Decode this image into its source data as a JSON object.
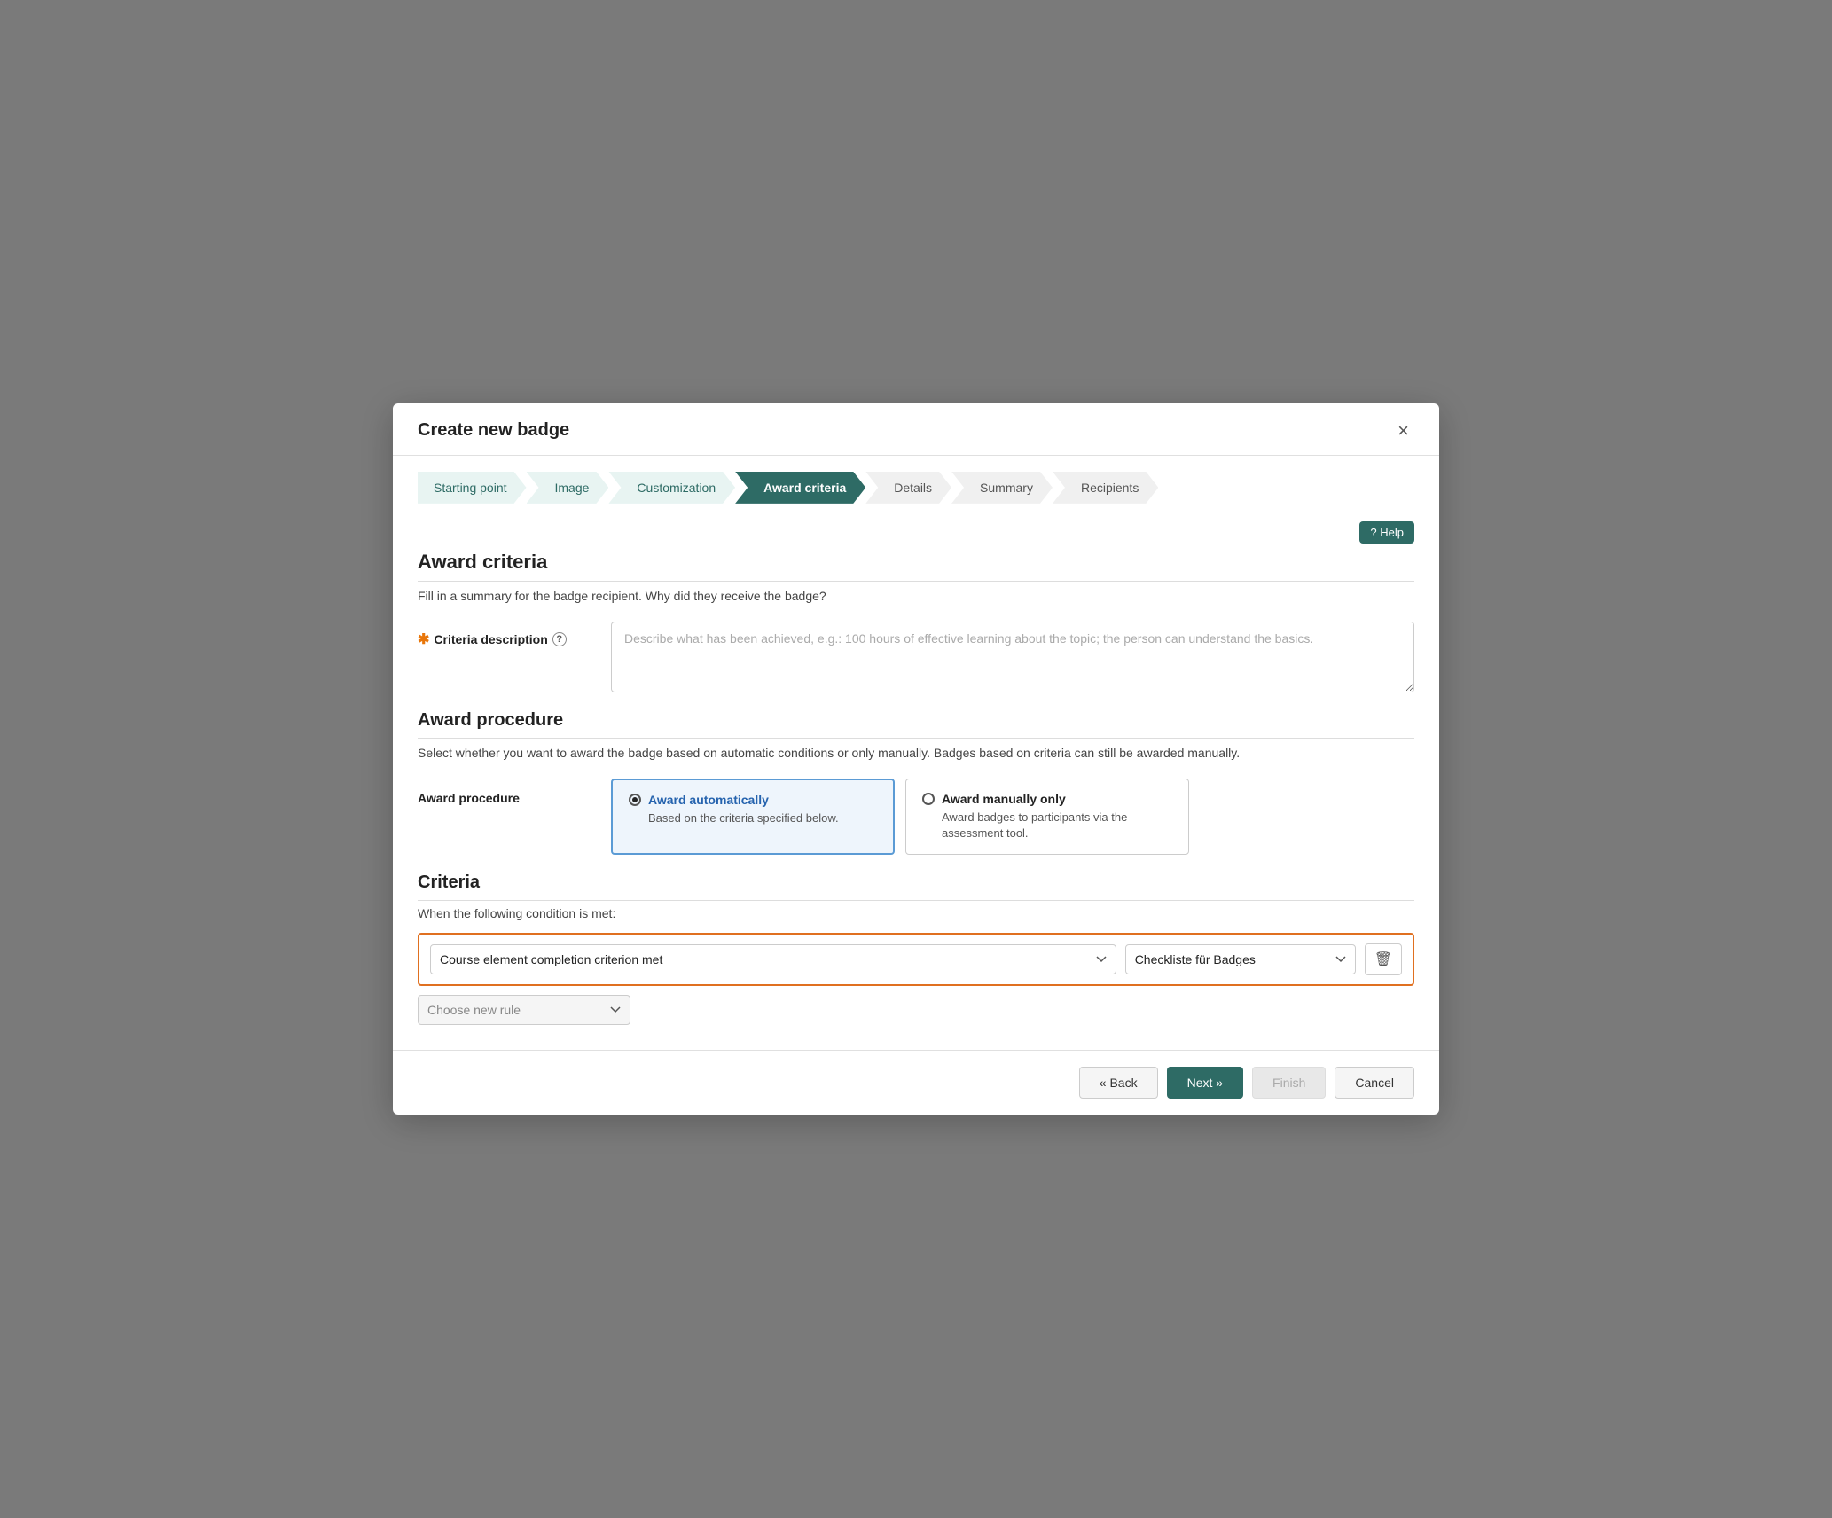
{
  "modal": {
    "title": "Create new badge",
    "close_label": "×"
  },
  "wizard": {
    "steps": [
      {
        "id": "starting-point",
        "label": "Starting point",
        "state": "completed"
      },
      {
        "id": "image",
        "label": "Image",
        "state": "completed"
      },
      {
        "id": "customization",
        "label": "Customization",
        "state": "completed"
      },
      {
        "id": "award-criteria",
        "label": "Award criteria",
        "state": "active"
      },
      {
        "id": "details",
        "label": "Details",
        "state": "inactive"
      },
      {
        "id": "summary",
        "label": "Summary",
        "state": "inactive"
      },
      {
        "id": "recipients",
        "label": "Recipients",
        "state": "inactive"
      }
    ]
  },
  "help_button": "? Help",
  "award_criteria": {
    "section_title": "Award criteria",
    "section_desc": "Fill in a summary for the badge recipient. Why did they receive the badge?",
    "criteria_description_label": "Criteria description",
    "criteria_description_placeholder": "Describe what has been achieved, e.g.: 100 hours of effective learning about the topic; the person can understand the basics."
  },
  "award_procedure": {
    "section_title": "Award procedure",
    "section_desc": "Select whether you want to award the badge based on automatic conditions or only manually. Badges based on criteria can still be awarded manually.",
    "label": "Award procedure",
    "options": [
      {
        "id": "auto",
        "title": "Award automatically",
        "desc": "Based on the criteria specified below.",
        "selected": true
      },
      {
        "id": "manual",
        "title": "Award manually only",
        "desc": "Award badges to participants via the assessment tool.",
        "selected": false
      }
    ]
  },
  "criteria": {
    "section_title": "Criteria",
    "condition_text": "When the following condition is met:",
    "rule": {
      "type_value": "Course element completion criterion met",
      "item_value": "Checkliste für Badges"
    },
    "new_rule_placeholder": "Choose new rule"
  },
  "footer": {
    "back_label": "« Back",
    "next_label": "Next »",
    "finish_label": "Finish",
    "cancel_label": "Cancel"
  }
}
